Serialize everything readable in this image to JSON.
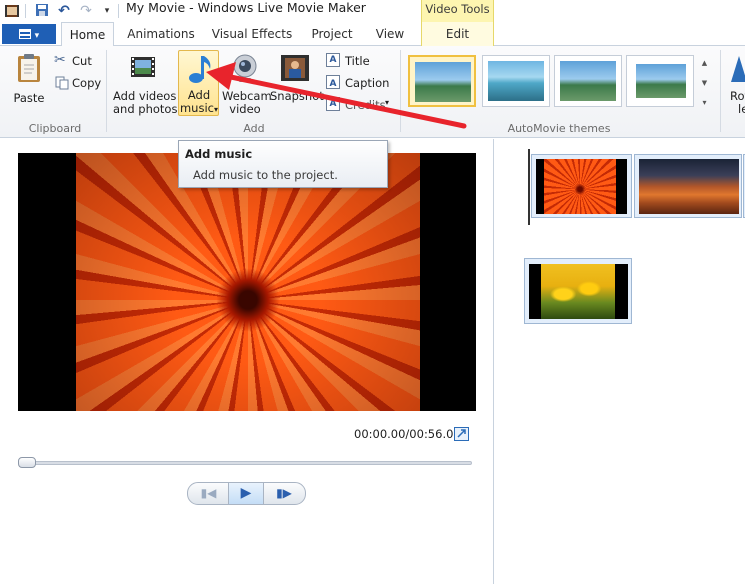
{
  "window": {
    "title": "My Movie - Windows Live Movie Maker"
  },
  "context_tab": {
    "label": "Video Tools"
  },
  "tabs": [
    {
      "label": "Home"
    },
    {
      "label": "Animations"
    },
    {
      "label": "Visual Effects"
    },
    {
      "label": "Project"
    },
    {
      "label": "View"
    },
    {
      "label": "Edit"
    }
  ],
  "clipboard": {
    "paste_label": "Paste",
    "cut_label": "Cut",
    "copy_label": "Copy",
    "group_label": "Clipboard"
  },
  "add": {
    "add_videos_line1": "Add videos",
    "add_videos_line2": "and photos",
    "add_music_line1": "Add",
    "add_music_line2": "music",
    "webcam_line1": "Webcam",
    "webcam_line2": "video",
    "snapshot_label": "Snapshot",
    "title_label": "Title",
    "caption_label": "Caption",
    "credits_label": "Credits",
    "group_label": "Add"
  },
  "themes": {
    "group_label": "AutoMovie themes"
  },
  "rotate": {
    "line1": "Rot",
    "line2": "le"
  },
  "tooltip": {
    "title": "Add music",
    "body": "Add music to the project."
  },
  "player": {
    "time": "00:00.00/00:56.00"
  },
  "colors": {
    "file_tab": "#1f5fb5",
    "context_tab": "#fdf5b0",
    "annotation_arrow": "#e8242c",
    "hover_highlight": "#ffe38f"
  }
}
